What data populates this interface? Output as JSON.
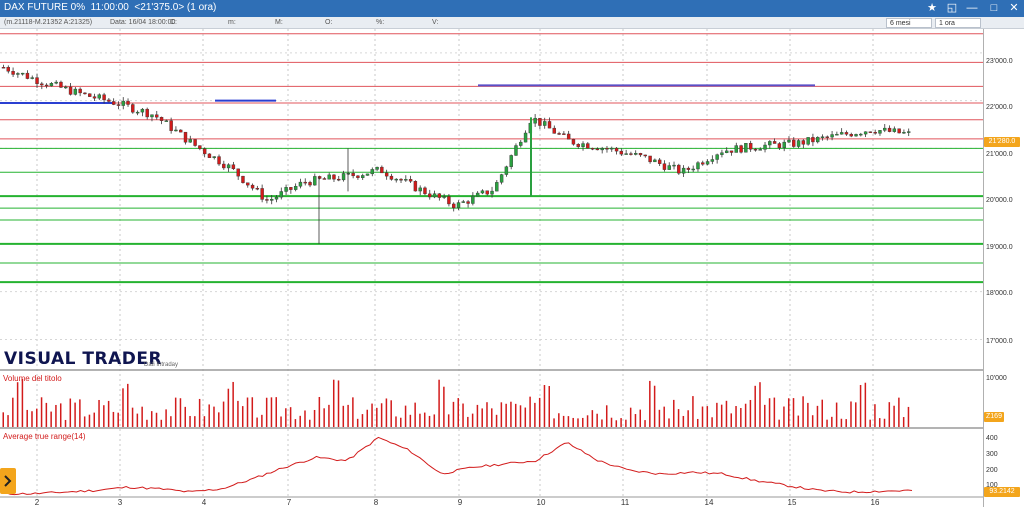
{
  "window": {
    "title": "DAX FUTURE 0%  11:00:00  <21'375.0> (1 ora)",
    "controls": [
      "★",
      "◱",
      "—",
      "□",
      "✕"
    ]
  },
  "infobar": {
    "ohlc": "(m.21118-M.21352 A:21325)",
    "date": "Data: 16/04 18:00:00",
    "c": "C:",
    "m": "m:",
    "mm": "M:",
    "o": "O:",
    "pct": "%:",
    "v": "V:",
    "period": "6 mesi",
    "timeframe": "1 ora"
  },
  "brand": {
    "name": "VISUAL TRADER",
    "sub": "Dati Intraday"
  },
  "colors": {
    "up": "#2aa040",
    "down": "#d21b1b",
    "resistance": "#e0555b",
    "support": "#25b330",
    "trendline": "#2b3fd1",
    "accent": "#f3a51c"
  },
  "panels": {
    "volume_title": "Volume del titolo",
    "atr_title": "Average true range(14)"
  },
  "price_axis": {
    "labels": [
      "23'000.0",
      "22'000.0",
      "21'000.0",
      "20'000.0",
      "19'000.0",
      "18'000.0",
      "17'000.0"
    ],
    "current_price": "21'280.0"
  },
  "volume_axis": {
    "labels": [
      "10'000"
    ],
    "current": "Z169"
  },
  "atr_axis": {
    "labels": [
      "400",
      "300",
      "200",
      "100"
    ],
    "current": "93.2142"
  },
  "x_axis": {
    "labels": [
      "2",
      "3",
      "4",
      "7",
      "8",
      "9",
      "10",
      "11",
      "14",
      "15",
      "16"
    ]
  },
  "chart_data": [
    {
      "type": "candlestick",
      "title": "DAX FUTURE 0%",
      "xlabel": "",
      "ylabel": "",
      "x": [
        "2",
        "3",
        "4",
        "7",
        "8",
        "9",
        "10",
        "11",
        "14",
        "15",
        "16"
      ],
      "ylim": [
        16800,
        23500
      ],
      "approx_close_path": [
        22700,
        22400,
        22150,
        21950,
        21700,
        21100,
        20600,
        19900,
        20300,
        20400,
        20550,
        20150,
        19800,
        20150,
        21650,
        21150,
        21000,
        20800,
        20500,
        20950,
        21050,
        21100,
        21250,
        21400,
        21300
      ],
      "horizontal_levels_support": [
        21000,
        20500,
        20000,
        19750,
        19500,
        19000,
        18600,
        18200
      ],
      "horizontal_levels_resistance": [
        23400,
        22800,
        22300,
        21950,
        21600,
        21200
      ],
      "trendlines": [
        "21900",
        "22300"
      ]
    },
    {
      "type": "bar",
      "title": "Volume del titolo",
      "xlabel": "",
      "ylabel": "",
      "categories": [
        "2",
        "3",
        "4",
        "7",
        "8",
        "9",
        "10",
        "11",
        "14",
        "15",
        "16"
      ],
      "ylim": [
        0,
        12000
      ]
    },
    {
      "type": "line",
      "title": "Average true range(14)",
      "xlabel": "",
      "ylabel": "",
      "x": [
        "2",
        "3",
        "4",
        "7",
        "8",
        "9",
        "10",
        "11",
        "14",
        "15",
        "16"
      ],
      "ylim": [
        80,
        480
      ],
      "approx_path": [
        100,
        100,
        110,
        120,
        140,
        130,
        110,
        130,
        190,
        260,
        320,
        300,
        440,
        360,
        220,
        260,
        280,
        300,
        410,
        300,
        240,
        220,
        230,
        220,
        180,
        150,
        120,
        110,
        115,
        120
      ]
    }
  ]
}
